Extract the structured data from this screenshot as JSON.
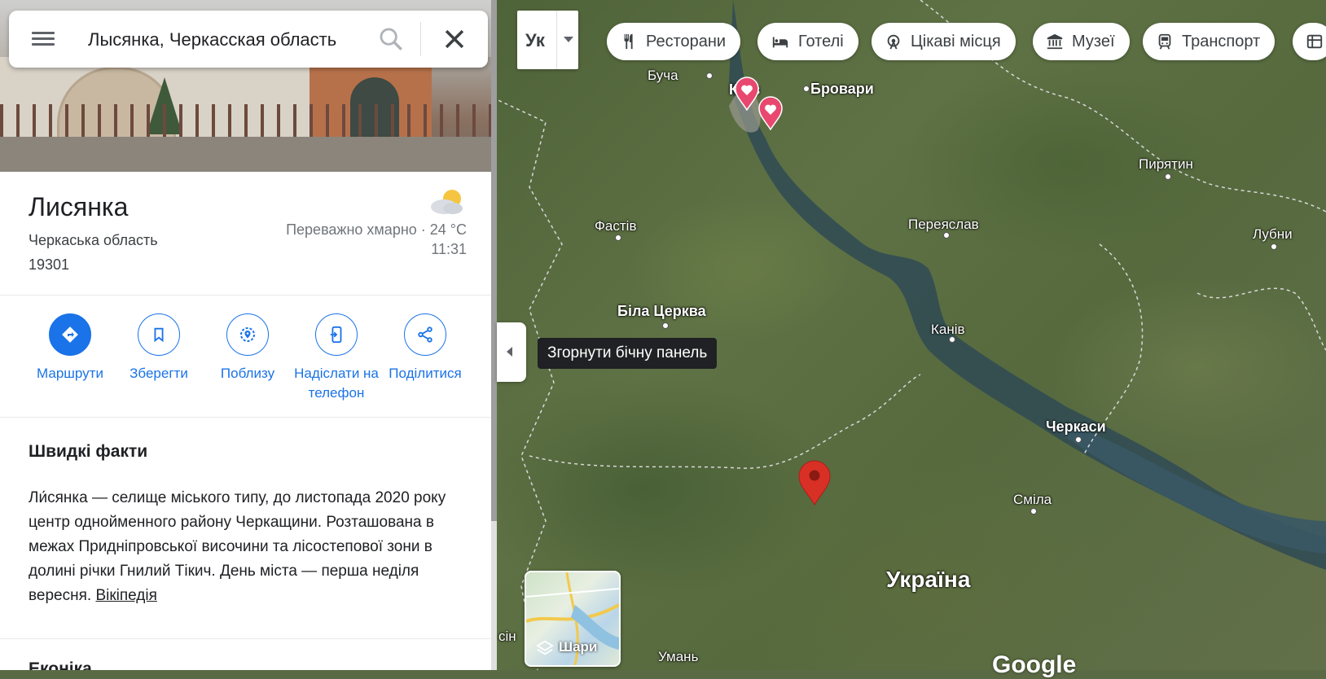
{
  "search": {
    "value": "Лысянка, Черкасская область"
  },
  "place": {
    "title": "Лисянка",
    "region": "Черкаська область",
    "postal": "19301"
  },
  "weather": {
    "condition": "Переважно хмарно · 24 °C",
    "time": "11:31",
    "icon": "partly-cloudy-icon"
  },
  "actions": [
    {
      "label": "Маршрути",
      "icon": "directions-icon"
    },
    {
      "label": "Зберегти",
      "icon": "bookmark-icon"
    },
    {
      "label": "Поблизу",
      "icon": "nearby-icon"
    },
    {
      "label": "Надіслати на телефон",
      "icon": "send-to-phone-icon"
    },
    {
      "label": "Поділитися",
      "icon": "share-icon"
    }
  ],
  "facts": {
    "title": "Швидкі факти",
    "text": "Ли́сянка — селище міського типу, до листопада 2020 року центр однойменного району Черкащини. Розташована в межах Придніпровської височини та лісостепової зони в долині річки Гнилий Тікич. День міста — перша неділя вересня.",
    "link": "Вікіпедія",
    "next_heading": "Еконіка"
  },
  "map": {
    "layer_toggle": "Ук",
    "chips": [
      {
        "label": "Ресторани",
        "icon": "restaurant-icon"
      },
      {
        "label": "Готелі",
        "icon": "hotel-icon"
      },
      {
        "label": "Цікаві місця",
        "icon": "attraction-icon"
      },
      {
        "label": "Музеї",
        "icon": "museum-icon"
      },
      {
        "label": "Транспорт",
        "icon": "transit-icon"
      }
    ],
    "tooltip": "Згорнути бічну панель",
    "layers_label": "Шари",
    "places": {
      "bucha": "Буча",
      "kyiv": "Київ",
      "brovary": "Бровари",
      "fastiv": "Фастів",
      "pereiaslav": "Переяслав",
      "pyriatyn": "Пирятин",
      "lubny": "Лубни",
      "bila_tserkva": "Біла Церква",
      "kaniv": "Канів",
      "cherkasy": "Черкаси",
      "smila": "Сміла",
      "ukraine": "Україна",
      "uman": "Умань",
      "edge_left": "сін"
    },
    "logo": "Google",
    "accent": "#1a73e8",
    "pin_color": "#d93025",
    "saved_pin_color": "#e8486f"
  }
}
